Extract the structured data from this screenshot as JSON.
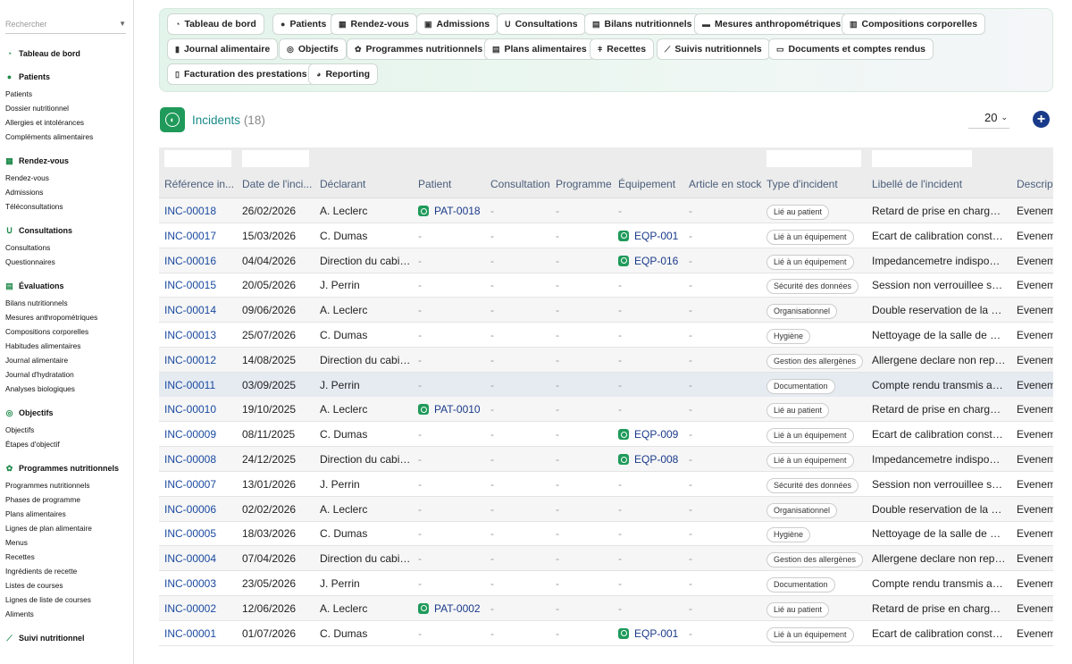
{
  "sidebar": {
    "search_placeholder": "Rechercher",
    "sections": [
      {
        "title": "Tableau de bord",
        "icon": "dashboard-icon",
        "items": []
      },
      {
        "title": "Patients",
        "icon": "person-icon",
        "items": [
          "Patients",
          "Dossier nutritionnel",
          "Allergies et intolérances",
          "Compléments alimentaires"
        ]
      },
      {
        "title": "Rendez-vous",
        "icon": "calendar-icon",
        "items": [
          "Rendez-vous",
          "Admissions",
          "Téléconsultations"
        ]
      },
      {
        "title": "Consultations",
        "icon": "stethoscope-icon",
        "items": [
          "Consultations",
          "Questionnaires"
        ]
      },
      {
        "title": "Évaluations",
        "icon": "clipboard-icon",
        "items": [
          "Bilans nutritionnels",
          "Mesures anthropométriques",
          "Compositions corporelles",
          "Habitudes alimentaires",
          "Journal alimentaire",
          "Journal d'hydratation",
          "Analyses biologiques"
        ]
      },
      {
        "title": "Objectifs",
        "icon": "target-icon",
        "items": [
          "Objectifs",
          "Étapes d'objectif"
        ]
      },
      {
        "title": "Programmes nutritionnels",
        "icon": "sprout-icon",
        "items": [
          "Programmes nutritionnels",
          "Phases de programme",
          "Plans alimentaires",
          "Lignes de plan alimentaire",
          "Menus",
          "Recettes",
          "Ingrédients de recette",
          "Listes de courses",
          "Lignes de liste de courses",
          "Aliments"
        ]
      },
      {
        "title": "Suivi nutritionnel",
        "icon": "chart-line-icon",
        "items": []
      }
    ]
  },
  "nav": [
    {
      "label": "Tableau de bord",
      "icon": "dashboard-icon"
    },
    {
      "label": "Patients",
      "icon": "person-icon"
    },
    {
      "label": "Rendez-vous",
      "icon": "calendar-icon"
    },
    {
      "label": "Admissions",
      "icon": "admission-icon"
    },
    {
      "label": "Consultations",
      "icon": "stethoscope-icon"
    },
    {
      "label": "Bilans nutritionnels",
      "icon": "clipboard-icon"
    },
    {
      "label": "Mesures anthropométriques",
      "icon": "ruler-icon"
    },
    {
      "label": "Compositions corporelles",
      "icon": "scale-icon"
    },
    {
      "label": "Journal alimentaire",
      "icon": "book-icon"
    },
    {
      "label": "Objectifs",
      "icon": "target-icon"
    },
    {
      "label": "Programmes nutritionnels",
      "icon": "sprout-icon"
    },
    {
      "label": "Plans alimentaires",
      "icon": "clipboard-icon"
    },
    {
      "label": "Recettes",
      "icon": "utensils-icon"
    },
    {
      "label": "Suivis nutritionnels",
      "icon": "chart-line-icon"
    },
    {
      "label": "Documents et comptes rendus",
      "icon": "document-icon"
    },
    {
      "label": "Facturation des prestations",
      "icon": "invoice-icon"
    },
    {
      "label": "Reporting",
      "icon": "pie-chart-icon"
    }
  ],
  "header": {
    "title": "Incidents",
    "count": "(18)",
    "per_page": "20"
  },
  "columns": [
    "Référence in...",
    "Date de l'inci...",
    "Déclarant",
    "Patient",
    "Consultation",
    "Programme",
    "Équipement",
    "Article en stock",
    "Type d'incident",
    "Libellé de l'incident",
    "Descript"
  ],
  "rows": [
    {
      "ref": "INC-00018",
      "date": "26/02/2026",
      "declarant": "A. Leclerc",
      "patient": "PAT-0018",
      "consultation": "-",
      "programme": "-",
      "equipement": "-",
      "article": "-",
      "type": "Lié au patient",
      "libelle": "Retard de prise en charge s...",
      "desc": "Evenem"
    },
    {
      "ref": "INC-00017",
      "date": "15/03/2026",
      "declarant": "C. Dumas",
      "patient": "-",
      "consultation": "-",
      "programme": "-",
      "equipement": "EQP-001",
      "article": "-",
      "type": "Lié à un équipement",
      "libelle": "Ecart de calibration constat...",
      "desc": "Evenem"
    },
    {
      "ref": "INC-00016",
      "date": "04/04/2026",
      "declarant": "Direction du cabinet",
      "patient": "-",
      "consultation": "-",
      "programme": "-",
      "equipement": "EQP-016",
      "article": "-",
      "type": "Lié à un équipement",
      "libelle": "Impedancemetre indisponibl...",
      "desc": "Evenem"
    },
    {
      "ref": "INC-00015",
      "date": "20/05/2026",
      "declarant": "J. Perrin",
      "patient": "-",
      "consultation": "-",
      "programme": "-",
      "equipement": "-",
      "article": "-",
      "type": "Sécurité des données",
      "libelle": "Session non verrouillee sur ...",
      "desc": "Evenem"
    },
    {
      "ref": "INC-00014",
      "date": "09/06/2026",
      "declarant": "A. Leclerc",
      "patient": "-",
      "consultation": "-",
      "programme": "-",
      "equipement": "-",
      "article": "-",
      "type": "Organisationnel",
      "libelle": "Double reservation de la sal...",
      "desc": "Evenem"
    },
    {
      "ref": "INC-00013",
      "date": "25/07/2026",
      "declarant": "C. Dumas",
      "patient": "-",
      "consultation": "-",
      "programme": "-",
      "equipement": "-",
      "article": "-",
      "type": "Hygiène",
      "libelle": "Nettoyage de la salle de me...",
      "desc": "Evenem"
    },
    {
      "ref": "INC-00012",
      "date": "14/08/2025",
      "declarant": "Direction du cabinet",
      "patient": "-",
      "consultation": "-",
      "programme": "-",
      "equipement": "-",
      "article": "-",
      "type": "Gestion des allergènes",
      "libelle": "Allergene declare non reper...",
      "desc": "Evenem"
    },
    {
      "ref": "INC-00011",
      "date": "03/09/2025",
      "declarant": "J. Perrin",
      "patient": "-",
      "consultation": "-",
      "programme": "-",
      "equipement": "-",
      "article": "-",
      "type": "Documentation",
      "libelle": "Compte rendu transmis ave...",
      "desc": "Evenem"
    },
    {
      "ref": "INC-00010",
      "date": "19/10/2025",
      "declarant": "A. Leclerc",
      "patient": "PAT-0010",
      "consultation": "-",
      "programme": "-",
      "equipement": "-",
      "article": "-",
      "type": "Lié au patient",
      "libelle": "Retard de prise en charge s...",
      "desc": "Evenem"
    },
    {
      "ref": "INC-00009",
      "date": "08/11/2025",
      "declarant": "C. Dumas",
      "patient": "-",
      "consultation": "-",
      "programme": "-",
      "equipement": "EQP-009",
      "article": "-",
      "type": "Lié à un équipement",
      "libelle": "Ecart de calibration constat...",
      "desc": "Evenem"
    },
    {
      "ref": "INC-00008",
      "date": "24/12/2025",
      "declarant": "Direction du cabinet",
      "patient": "-",
      "consultation": "-",
      "programme": "-",
      "equipement": "EQP-008",
      "article": "-",
      "type": "Lié à un équipement",
      "libelle": "Impedancemetre indisponibl...",
      "desc": "Evenem"
    },
    {
      "ref": "INC-00007",
      "date": "13/01/2026",
      "declarant": "J. Perrin",
      "patient": "-",
      "consultation": "-",
      "programme": "-",
      "equipement": "-",
      "article": "-",
      "type": "Sécurité des données",
      "libelle": "Session non verrouillee sur ...",
      "desc": "Evenem"
    },
    {
      "ref": "INC-00006",
      "date": "02/02/2026",
      "declarant": "A. Leclerc",
      "patient": "-",
      "consultation": "-",
      "programme": "-",
      "equipement": "-",
      "article": "-",
      "type": "Organisationnel",
      "libelle": "Double reservation de la sal...",
      "desc": "Evenem"
    },
    {
      "ref": "INC-00005",
      "date": "18/03/2026",
      "declarant": "C. Dumas",
      "patient": "-",
      "consultation": "-",
      "programme": "-",
      "equipement": "-",
      "article": "-",
      "type": "Hygiène",
      "libelle": "Nettoyage de la salle de me...",
      "desc": "Evenem"
    },
    {
      "ref": "INC-00004",
      "date": "07/04/2026",
      "declarant": "Direction du cabinet",
      "patient": "-",
      "consultation": "-",
      "programme": "-",
      "equipement": "-",
      "article": "-",
      "type": "Gestion des allergènes",
      "libelle": "Allergene declare non reper...",
      "desc": "Evenem"
    },
    {
      "ref": "INC-00003",
      "date": "23/05/2026",
      "declarant": "J. Perrin",
      "patient": "-",
      "consultation": "-",
      "programme": "-",
      "equipement": "-",
      "article": "-",
      "type": "Documentation",
      "libelle": "Compte rendu transmis ave...",
      "desc": "Evenem"
    },
    {
      "ref": "INC-00002",
      "date": "12/06/2026",
      "declarant": "A. Leclerc",
      "patient": "PAT-0002",
      "consultation": "-",
      "programme": "-",
      "equipement": "-",
      "article": "-",
      "type": "Lié au patient",
      "libelle": "Retard de prise en charge s...",
      "desc": "Evenem"
    },
    {
      "ref": "INC-00001",
      "date": "01/07/2026",
      "declarant": "C. Dumas",
      "patient": "-",
      "consultation": "-",
      "programme": "-",
      "equipement": "EQP-001",
      "article": "-",
      "type": "Lié à un équipement",
      "libelle": "Ecart de calibration constat...",
      "desc": "Evenem"
    }
  ],
  "colors": {
    "accent": "#1f9a5a",
    "link": "#1a4aa0",
    "title": "#1a8a8a",
    "add": "#1a3a8a"
  }
}
